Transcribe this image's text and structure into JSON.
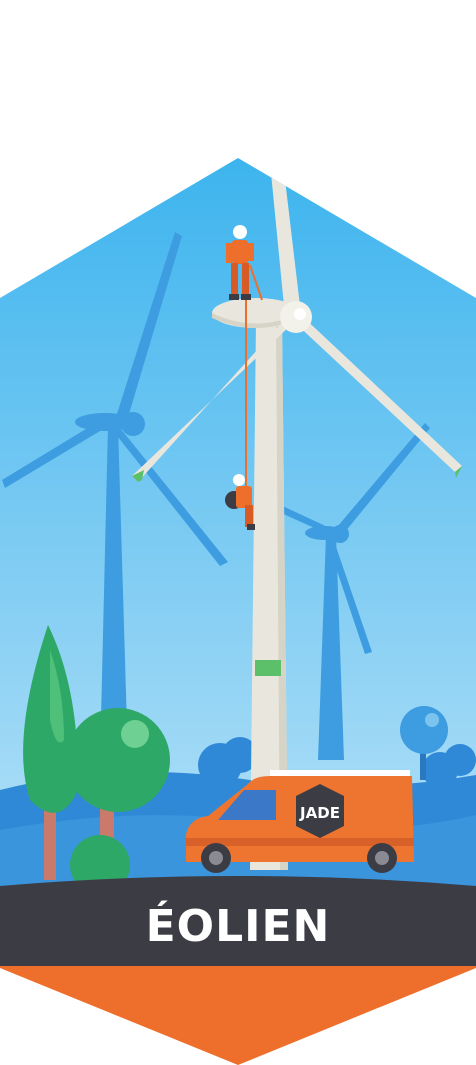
{
  "banner": {
    "label": "ÉOLIEN"
  },
  "van": {
    "brand": "JADE"
  },
  "colors": {
    "sky_top": "#3fb6ee",
    "sky_bottom": "#bfe6f8",
    "turbine_bg": "#3d9de0",
    "turbine_main": "#e9e7dd",
    "turbine_accent": "#5cbf6a",
    "tree": "#2ea866",
    "hills": "#2f89d6",
    "van": "#ee7530",
    "banner_dark": "#3c3c45",
    "banner_orange": "#ee6f2c",
    "worker": "#ee6f2c"
  }
}
